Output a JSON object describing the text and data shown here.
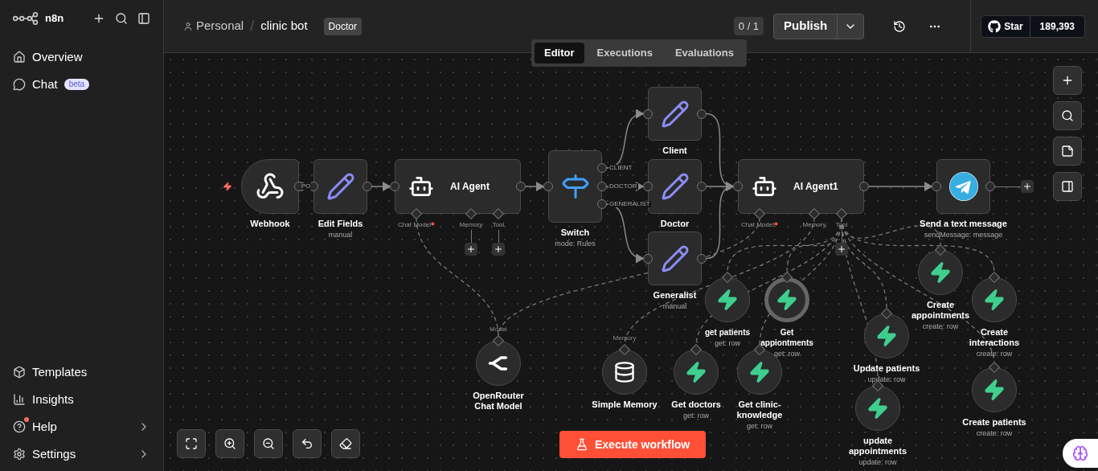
{
  "sidebar": {
    "brand": "n8n",
    "nav": [
      {
        "label": "Overview"
      },
      {
        "label": "Chat",
        "badge": "beta"
      }
    ],
    "footer": [
      {
        "label": "Templates",
        "notification": false,
        "chevron": false
      },
      {
        "label": "Insights",
        "notification": false,
        "chevron": false
      },
      {
        "label": "Help",
        "notification": true,
        "chevron": true
      },
      {
        "label": "Settings",
        "notification": false,
        "chevron": true
      }
    ]
  },
  "header": {
    "breadcrumb": [
      "Personal",
      "clinic bot"
    ],
    "separator": "/",
    "tag": "Doctor",
    "counter": "0 / 1",
    "publish": "Publish",
    "github": {
      "label": "Star",
      "count": "189,393"
    }
  },
  "tabs": [
    {
      "label": "Editor",
      "selected": true
    },
    {
      "label": "Executions",
      "selected": false
    },
    {
      "label": "Evaluations",
      "selected": false
    }
  ],
  "canvas": {
    "nodes": [
      {
        "kind": "trigger",
        "label": "Webhook",
        "output_label": "PO",
        "selected": false
      },
      {
        "kind": "square",
        "label": "Edit Fields",
        "subtitle": "manual",
        "selected": false
      },
      {
        "kind": "wide",
        "label": "AI Agent",
        "selected": false,
        "ports": [
          {
            "label": "Chat Model",
            "required": true,
            "add_button": false
          },
          {
            "label": "Memory",
            "required": false,
            "add_button": true
          },
          {
            "label": "Tool",
            "required": false,
            "add_button": true
          }
        ]
      },
      {
        "kind": "square",
        "label": "Switch",
        "subtitle": "mode: Rules",
        "selected": false,
        "outputs": [
          "CLIENT",
          "DOCTOR",
          "GENERALIST"
        ]
      },
      {
        "kind": "square",
        "label": "Client",
        "selected": false
      },
      {
        "kind": "square",
        "label": "Doctor",
        "selected": false
      },
      {
        "kind": "square",
        "label": "Generalist",
        "subtitle": "manual",
        "selected": false
      },
      {
        "kind": "wide",
        "label": "AI Agent1",
        "selected": false,
        "ports": [
          {
            "label": "Chat Model",
            "required": true,
            "add_button": false
          },
          {
            "label": "Memory",
            "required": false,
            "add_button": false
          },
          {
            "label": "Tool",
            "required": false,
            "add_button": true
          }
        ]
      },
      {
        "kind": "square",
        "label": "Send a text message",
        "subtitle": "sendMessage: message",
        "selected": false,
        "add_after": true
      },
      {
        "kind": "circle",
        "label": "OpenRouter Chat Model",
        "input_label": "Model",
        "selected": false
      },
      {
        "kind": "circle",
        "label": "Simple Memory",
        "input_label": "Memory",
        "selected": false
      },
      {
        "kind": "circle",
        "label": "get patients",
        "subtitle": "get: row",
        "selected": false
      },
      {
        "kind": "circle",
        "label": "Get appiontments",
        "subtitle": "get: row",
        "selected": true
      },
      {
        "kind": "circle",
        "label": "Get doctors",
        "subtitle": "get: row",
        "selected": false
      },
      {
        "kind": "circle",
        "label": "Get clinic-knowledge",
        "subtitle": "get: row",
        "selected": false
      },
      {
        "kind": "circle",
        "label": "Create appointments",
        "subtitle": "create: row",
        "selected": false
      },
      {
        "kind": "circle",
        "label": "Create interactions",
        "subtitle": "create: row",
        "selected": false
      },
      {
        "kind": "circle",
        "label": "Update patients",
        "subtitle": "update: row",
        "selected": false
      },
      {
        "kind": "circle",
        "label": "update appointments",
        "subtitle": "update: row",
        "selected": false
      },
      {
        "kind": "circle",
        "label": "Create patients",
        "subtitle": "create: row",
        "selected": false
      }
    ],
    "execute_button": "Execute workflow"
  }
}
